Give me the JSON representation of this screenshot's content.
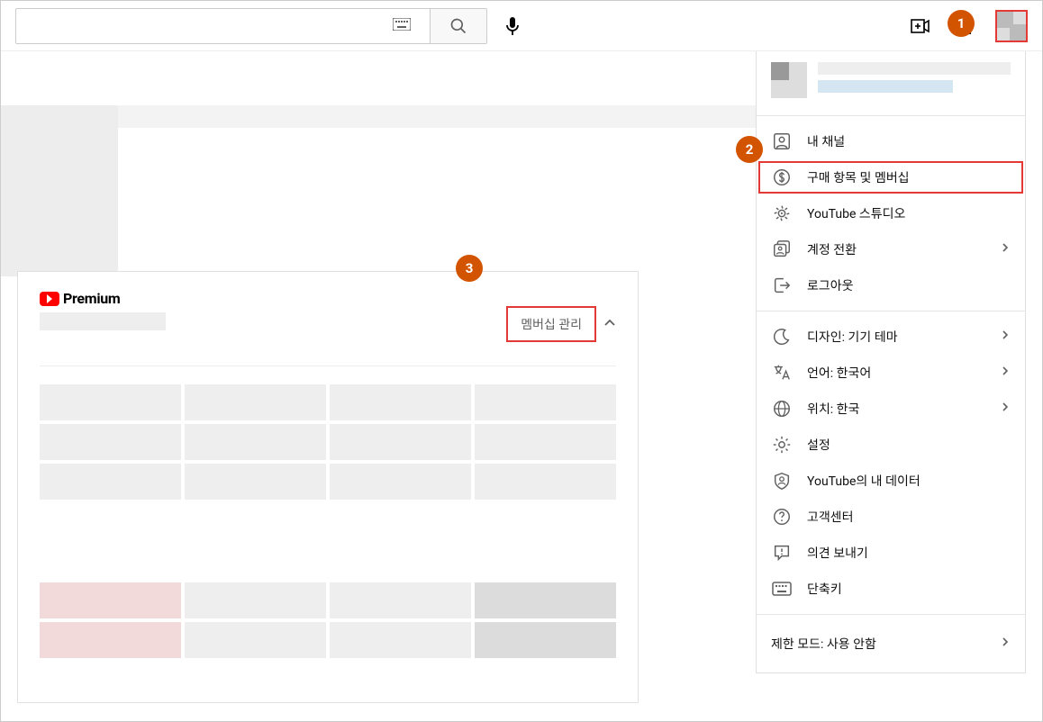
{
  "search": {
    "placeholder": ""
  },
  "premium": {
    "brand": "Premium",
    "manage_label": "멤버십 관리"
  },
  "menu": {
    "my_channel": "내 채널",
    "purchases": "구매 항목 및 멤버십",
    "studio": "YouTube 스튜디오",
    "switch_account": "계정 전환",
    "sign_out": "로그아웃",
    "appearance": "디자인: 기기 테마",
    "language": "언어: 한국어",
    "location": "위치: 한국",
    "settings": "설정",
    "your_data": "YouTube의 내 데이터",
    "help": "고객센터",
    "feedback": "의견 보내기",
    "shortcuts": "단축키",
    "restricted": "제한 모드: 사용 안함"
  },
  "anno": {
    "one": "1",
    "two": "2",
    "three": "3"
  }
}
